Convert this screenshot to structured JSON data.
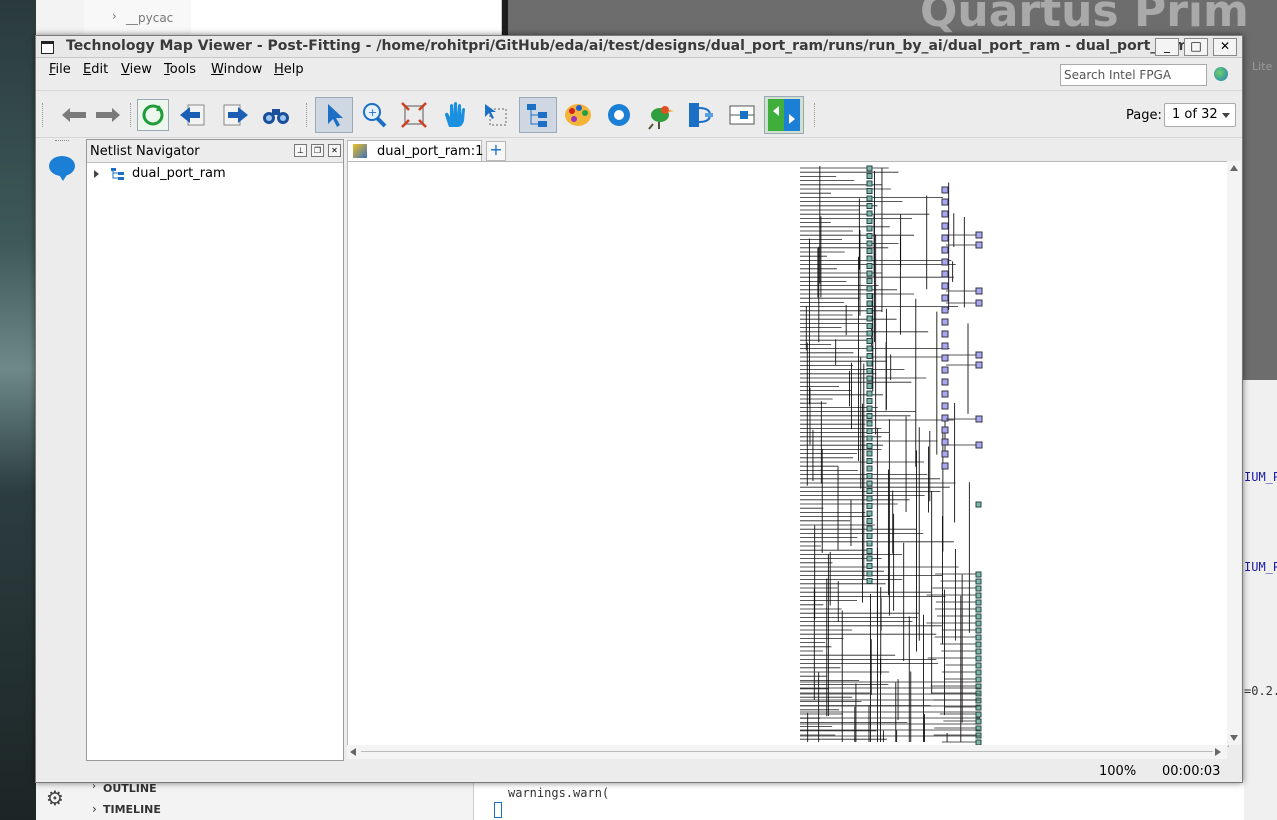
{
  "background": {
    "vscode_tree_item": "__pycac",
    "quartus_title": "Quartus Prim",
    "quartus_edition": "Lite",
    "code_lines": [
      "IUM_P",
      "IUM_P",
      "=0.2."
    ],
    "bottom_items": [
      "OUTLINE",
      "TIMELINE"
    ],
    "terminal_text": "warnings.warn("
  },
  "window": {
    "title": "Technology Map Viewer - Post-Fitting - /home/rohitpri/GitHub/eda/ai/test/designs/dual_port_ram/runs/run_by_ai/dual_port_ram - dual_port_ram",
    "controls": [
      "_",
      "□",
      "✕"
    ]
  },
  "menu": {
    "items": [
      {
        "label": "File",
        "mnemonic": "F"
      },
      {
        "label": "Edit",
        "mnemonic": "E"
      },
      {
        "label": "View",
        "mnemonic": "V"
      },
      {
        "label": "Tools",
        "mnemonic": "T"
      },
      {
        "label": "Window",
        "mnemonic": "W"
      },
      {
        "label": "Help",
        "mnemonic": "H"
      }
    ],
    "search_placeholder": "Search Intel FPGA"
  },
  "toolbar": {
    "icons": [
      "back-arrow-icon",
      "forward-arrow-icon",
      "refresh-icon",
      "previous-page-icon",
      "next-page-icon",
      "find-binoculars-icon",
      "select-pointer-icon",
      "zoom-icon",
      "fit-window-icon",
      "hand-pan-icon",
      "rubberband-select-icon",
      "hierarchy-icon",
      "color-palette-icon",
      "settings-gear-icon",
      "bird-eye-view-icon",
      "netlist-export-icon",
      "schematic-view-icon",
      "split-view-icon"
    ],
    "page_label": "Page:",
    "page_value": "1 of 32"
  },
  "navigator": {
    "title": "Netlist Navigator",
    "tree": [
      {
        "label": "dual_port_ram"
      }
    ]
  },
  "viewer": {
    "tab_label": "dual_port_ram:1",
    "add_tab": "+"
  },
  "status": {
    "zoom": "100%",
    "time": "00:00:03"
  }
}
